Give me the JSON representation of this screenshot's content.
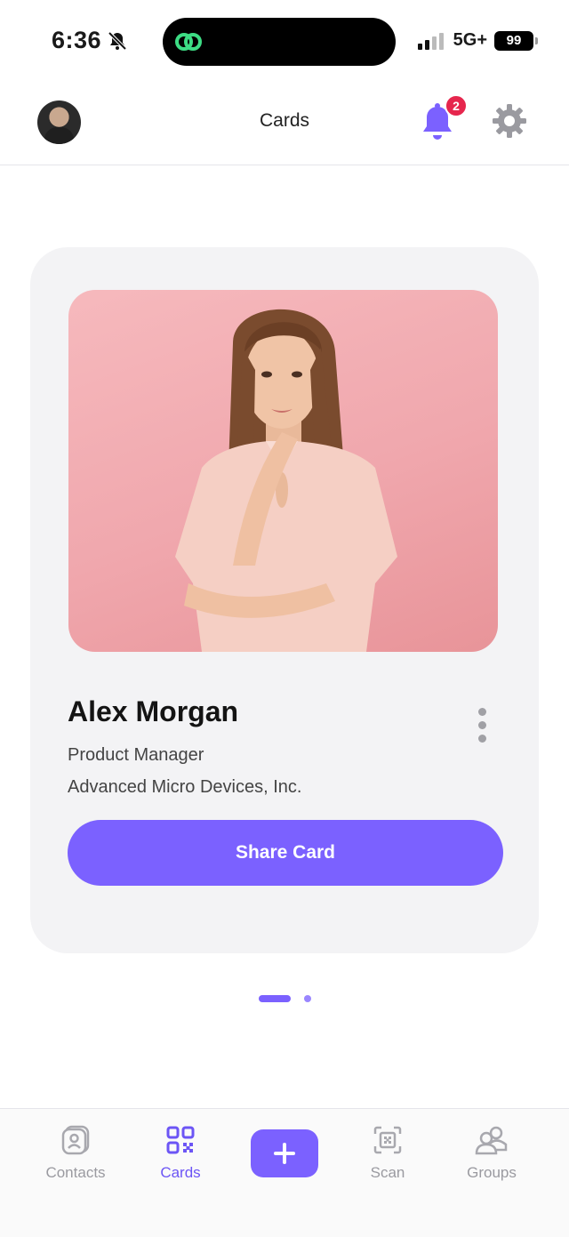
{
  "status_bar": {
    "time": "6:36",
    "network": "5G+",
    "battery": "99"
  },
  "header": {
    "title": "Cards",
    "notification_count": "2"
  },
  "card": {
    "name": "Alex Morgan",
    "title": "Product Manager",
    "company": "Advanced Micro Devices, Inc.",
    "share_label": "Share Card"
  },
  "pager": {
    "current": 1,
    "total": 2
  },
  "tabbar": {
    "tabs": [
      {
        "label": "Contacts",
        "icon": "contacts-icon",
        "active": false
      },
      {
        "label": "Cards",
        "icon": "qr-code-icon",
        "active": true
      },
      {
        "label": "Scan",
        "icon": "scan-icon",
        "active": false
      },
      {
        "label": "Groups",
        "icon": "groups-icon",
        "active": false
      }
    ],
    "add_icon": "plus-icon"
  },
  "colors": {
    "accent": "#7b61ff",
    "badge": "#e6264d",
    "card_bg": "#f3f3f5"
  }
}
